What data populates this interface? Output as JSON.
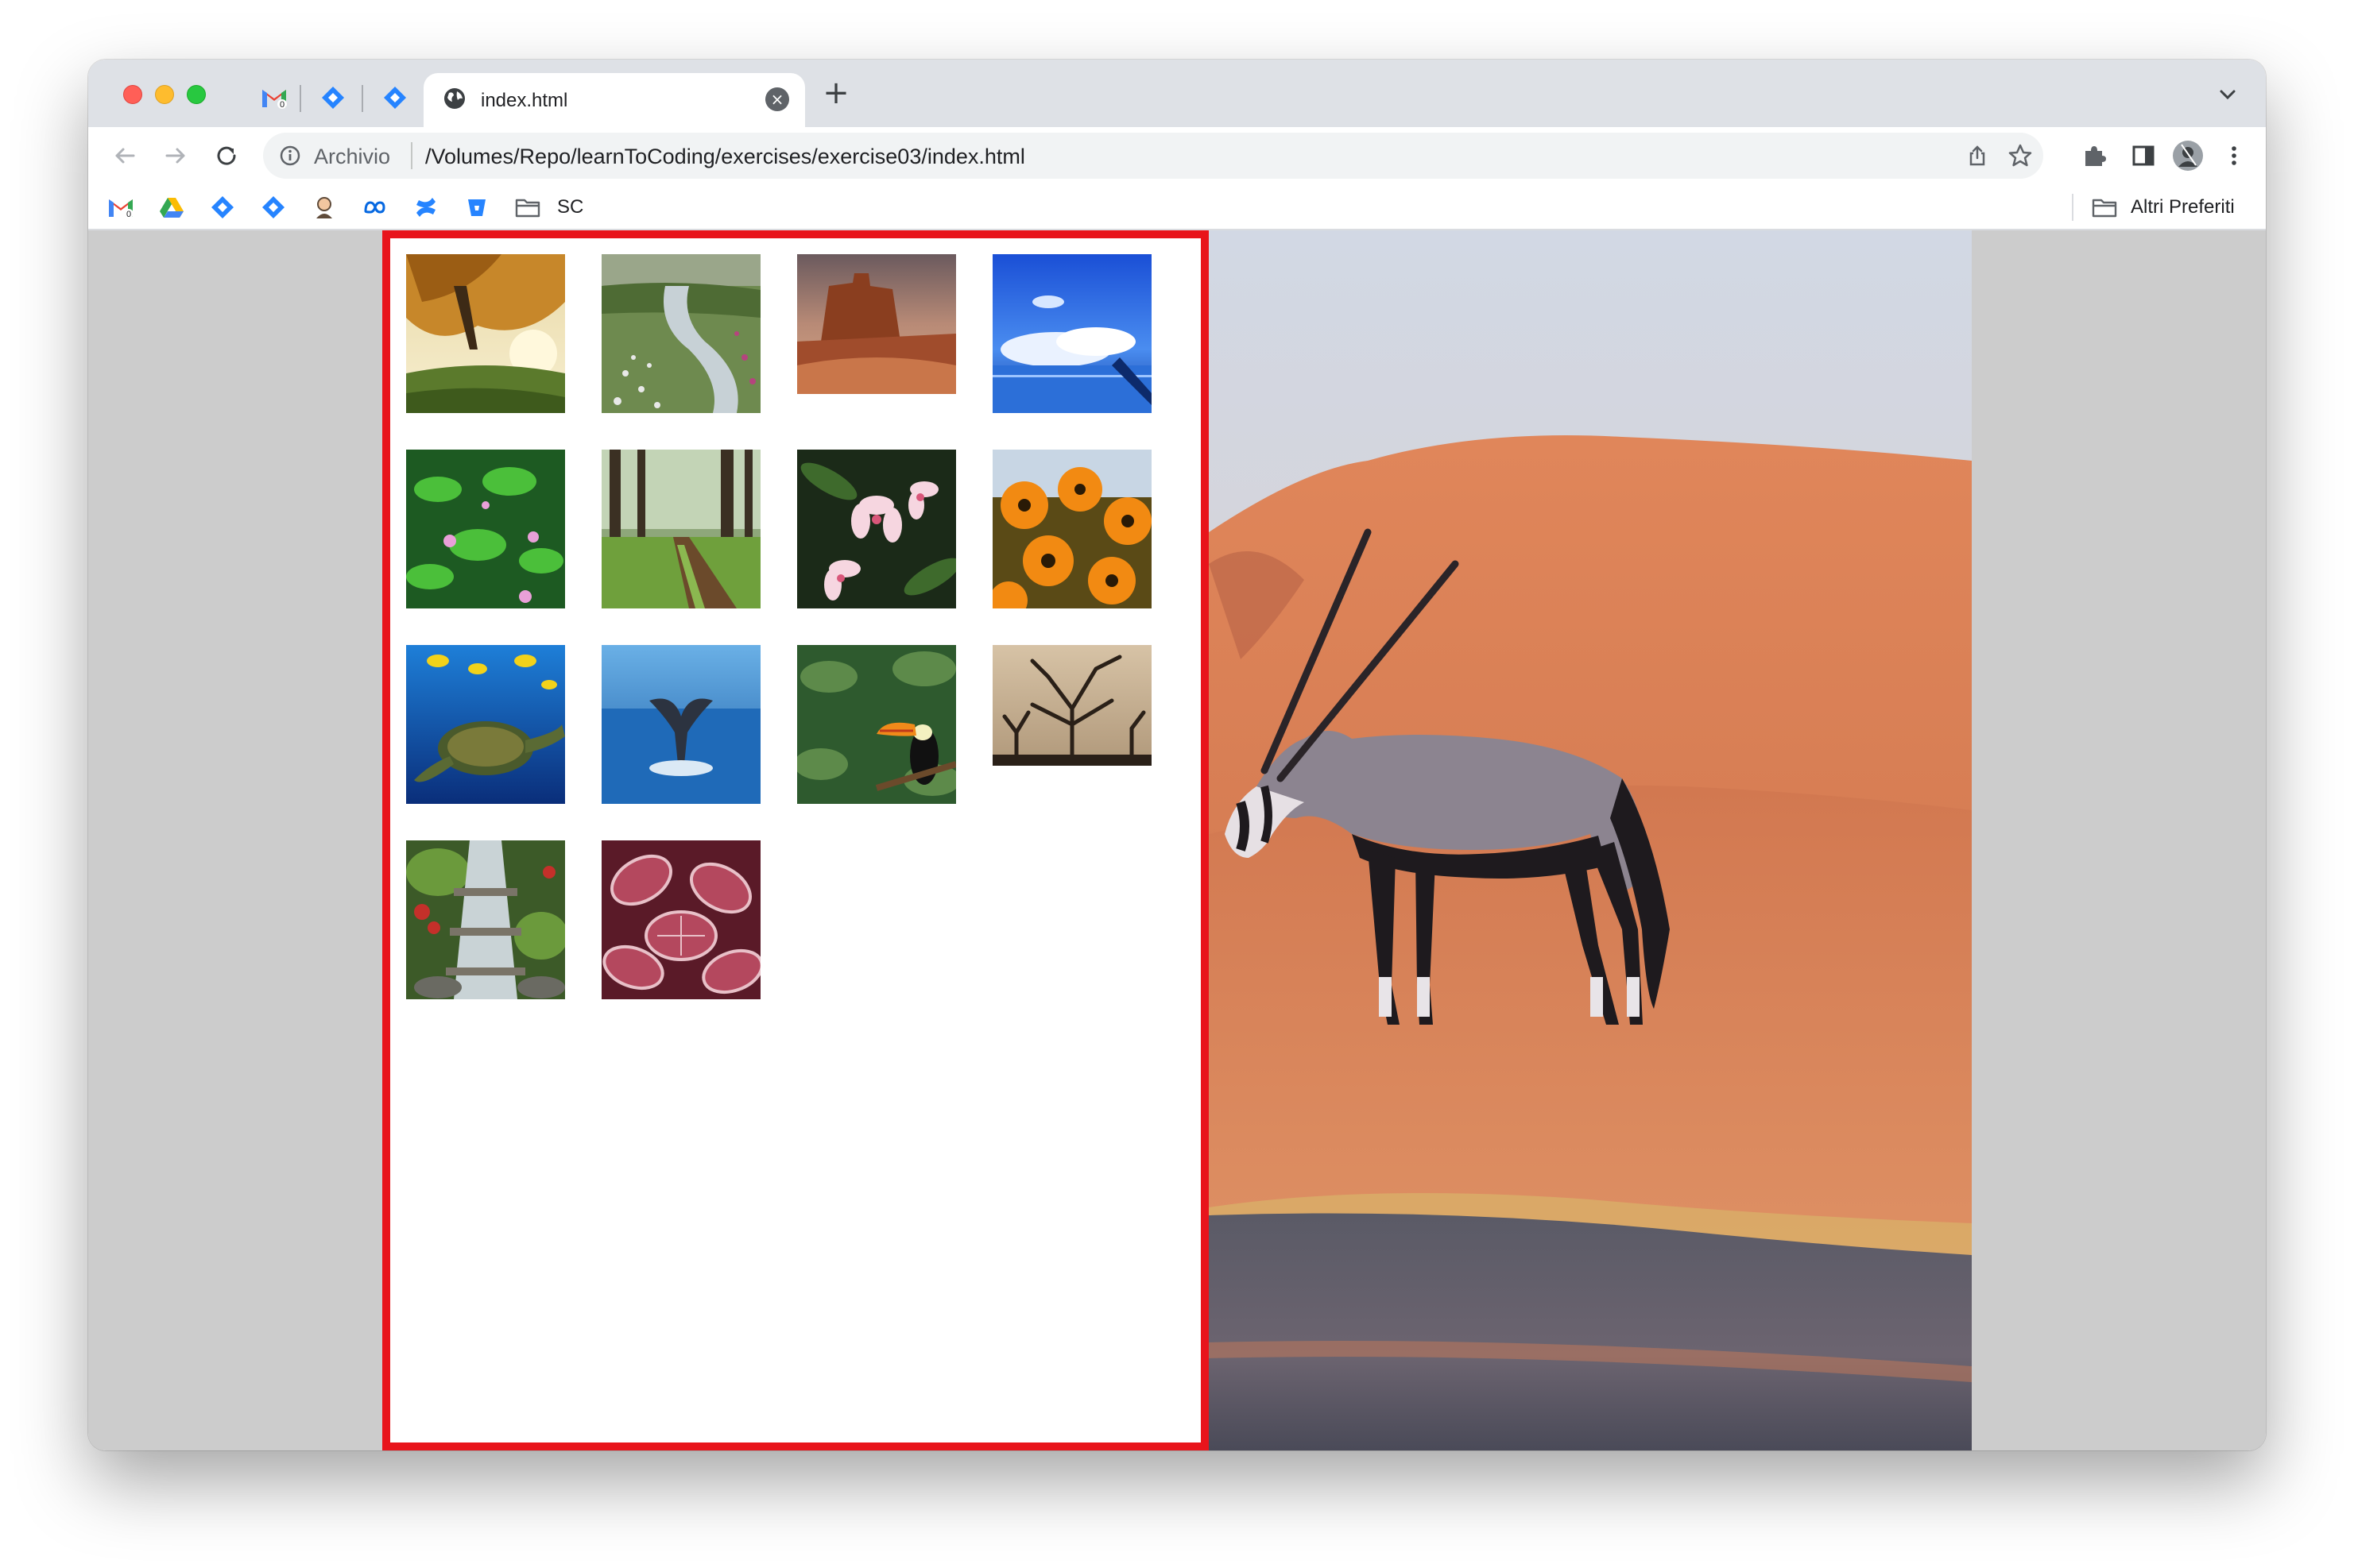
{
  "browser": {
    "tab": {
      "title": "index.html",
      "close": "×"
    },
    "new_tab": "+",
    "omnibox": {
      "scheme_label": "Archivio",
      "url": "/Volumes/Repo/learnToCoding/exercises/exercise03/index.html"
    },
    "bookmarks": {
      "folder_label": "SC",
      "other_label": "Altri Preferiti"
    }
  },
  "colors": {
    "gallery_border": "#e8141b",
    "page_background": "#cccccc"
  },
  "gallery": {
    "thumbnails": [
      {
        "subject": "autumn tree"
      },
      {
        "subject": "mountain stream"
      },
      {
        "subject": "desert butte"
      },
      {
        "subject": "sky over lake"
      },
      {
        "subject": "green leaves pink flowers"
      },
      {
        "subject": "forest path"
      },
      {
        "subject": "frangipani flowers"
      },
      {
        "subject": "orange daisies"
      },
      {
        "subject": "sea turtle"
      },
      {
        "subject": "whale tail"
      },
      {
        "subject": "toucan"
      },
      {
        "subject": "tree silhouette"
      },
      {
        "subject": "waterfall garden"
      },
      {
        "subject": "frosty leaves"
      }
    ]
  },
  "hero": {
    "subject": "oryx in desert dunes"
  }
}
